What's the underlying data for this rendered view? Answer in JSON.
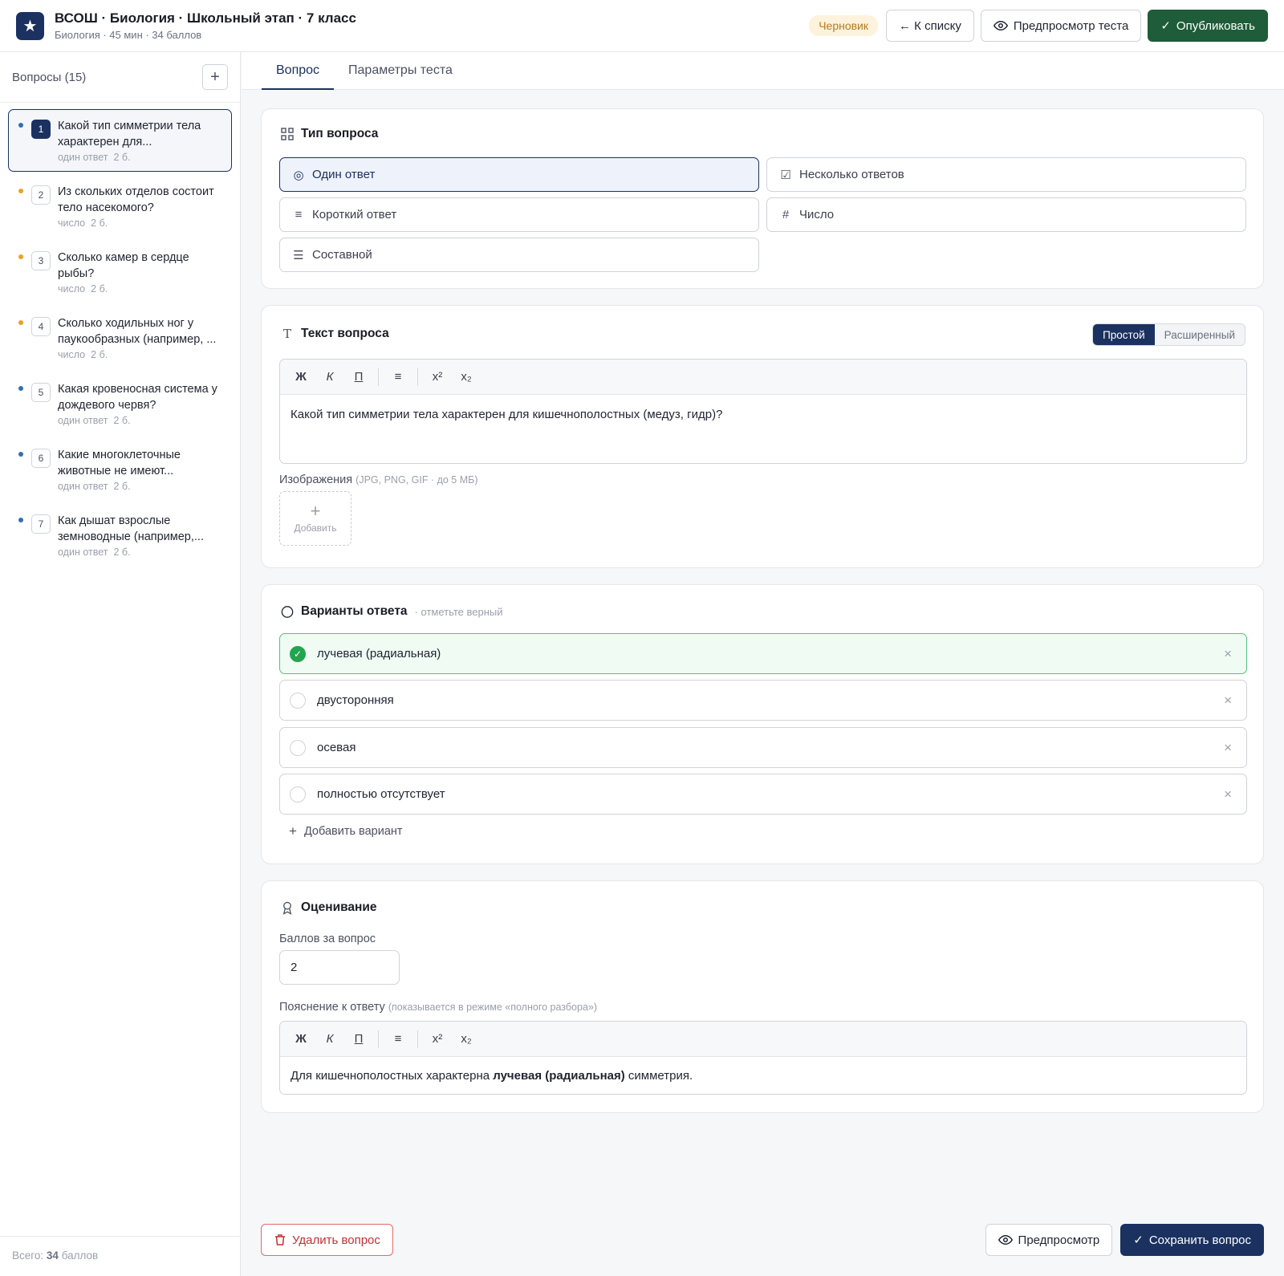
{
  "header": {
    "title": "ВСОШ · Биология · Школьный этап · 7 класс",
    "subtitle": "Биология · 45 мин · 34 баллов",
    "status_badge": "Черновик",
    "back_label": "← К списку",
    "preview_label": "Предпросмотр теста",
    "publish_label": "Опубликовать"
  },
  "sidebar": {
    "title": "Вопросы (15)",
    "add_label": "+",
    "items": [
      {
        "num": "1",
        "text": "Какой тип симметрии тела характерен для...",
        "type": "один ответ",
        "points": "2 б.",
        "dot": "#2f6fb8",
        "active": true
      },
      {
        "num": "2",
        "text": "Из скольких отделов состоит тело насекомого?",
        "type": "число",
        "points": "2 б.",
        "dot": "#f0a020"
      },
      {
        "num": "3",
        "text": "Сколько камер в сердце рыбы?",
        "type": "число",
        "points": "2 б.",
        "dot": "#f0a020"
      },
      {
        "num": "4",
        "text": "Сколько ходильных ног у паукообразных (например, ...",
        "type": "число",
        "points": "2 б.",
        "dot": "#f0a020"
      },
      {
        "num": "5",
        "text": "Какая кровеносная система у дождевого червя?",
        "type": "один ответ",
        "points": "2 б.",
        "dot": "#2f6fb8"
      },
      {
        "num": "6",
        "text": "Какие многоклеточные животные не имеют...",
        "type": "один ответ",
        "points": "2 б.",
        "dot": "#2f6fb8"
      },
      {
        "num": "7",
        "text": "Как дышат взрослые земноводные (например,...",
        "type": "один ответ",
        "points": "2 б.",
        "dot": "#2f6fb8"
      }
    ],
    "footer_prefix": "Всего: ",
    "footer_total": "34",
    "footer_suffix": " баллов"
  },
  "tabs": [
    "Вопрос",
    "Параметры теста"
  ],
  "question_type": {
    "title": "Тип вопроса",
    "options": [
      {
        "label": "Один ответ",
        "icon": "◎"
      },
      {
        "label": "Несколько ответов",
        "icon": "☑"
      },
      {
        "label": "Короткий ответ",
        "icon": "≡"
      },
      {
        "label": "Число",
        "icon": "#"
      },
      {
        "label": "Составной",
        "icon": "☰"
      }
    ]
  },
  "question_text": {
    "title": "Текст вопроса",
    "mode_simple": "Простой",
    "mode_extended": "Расширенный",
    "toolbar": [
      "Ж",
      "К",
      "П",
      "≡",
      "x²",
      "x₂"
    ],
    "content": "Какой тип симметрии тела характерен для кишечнополостных (медуз, гидр)?",
    "images_label": "Изображения",
    "images_hint": "(JPG, PNG, GIF · до 5 МБ)",
    "add_image_label": "Добавить"
  },
  "answers": {
    "title": "Варианты ответа",
    "hint": "· отметьте верный",
    "options": [
      {
        "text": "лучевая (радиальная)",
        "correct": true
      },
      {
        "text": "двусторонняя",
        "correct": false
      },
      {
        "text": "осевая",
        "correct": false
      },
      {
        "text": "полностью отсутствует",
        "correct": false
      }
    ],
    "add_label": "Добавить вариант"
  },
  "grading": {
    "title": "Оценивание",
    "points_label": "Баллов за вопрос",
    "points_value": "2",
    "explanation_label": "Пояснение к ответу",
    "explanation_hint": "(показывается в режиме «полного разбора»)",
    "explanation_before": "Для кишечнополостных характерна ",
    "explanation_bold": "лучевая (радиальная)",
    "explanation_after": " симметрия."
  },
  "footer": {
    "delete_label": "Удалить вопрос",
    "preview_label": "Предпросмотр",
    "save_label": "Сохранить вопрос"
  }
}
